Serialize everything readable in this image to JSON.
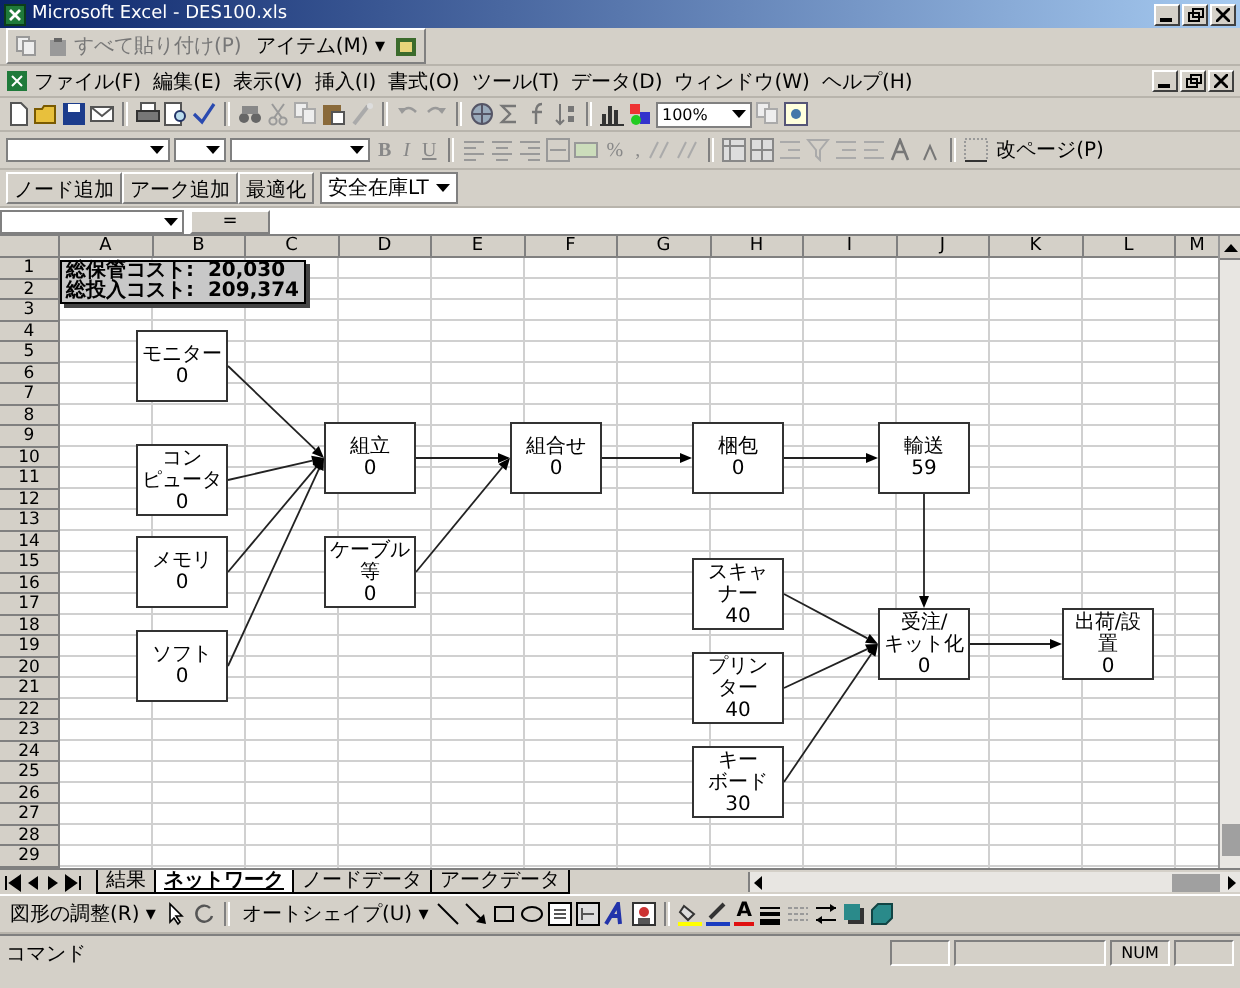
{
  "window": {
    "title": "Microsoft Excel - DES100.xls"
  },
  "paste_toolbar": {
    "paste_all": "すべて貼り付け(P)",
    "items_menu": "アイテム(M) ▾"
  },
  "menu": [
    "ファイル(F)",
    "編集(E)",
    "表示(V)",
    "挿入(I)",
    "書式(O)",
    "ツール(T)",
    "データ(D)",
    "ウィンドウ(W)",
    "ヘルプ(H)"
  ],
  "standard_toolbar": {
    "zoom": "100%"
  },
  "formatting_toolbar": {
    "style_buttons": [
      "B",
      "I",
      "U"
    ],
    "number_buttons": [
      "%",
      ","
    ],
    "page_break": "改ページ(P)"
  },
  "custom_toolbar": {
    "buttons": [
      "ノード追加",
      "アーク追加",
      "最適化"
    ],
    "dropdown": "安全在庫LT"
  },
  "formula_bar": {
    "equals": "="
  },
  "sheet": {
    "columns": [
      "A",
      "B",
      "C",
      "D",
      "E",
      "F",
      "G",
      "H",
      "I",
      "J",
      "K",
      "L",
      "M"
    ],
    "rows": [
      "1",
      "2",
      "3",
      "4",
      "5",
      "6",
      "7",
      "8",
      "9",
      "10",
      "11",
      "12",
      "13",
      "14",
      "15",
      "16",
      "17",
      "18",
      "19",
      "20",
      "21",
      "22",
      "23",
      "24",
      "25",
      "26",
      "27",
      "28",
      "29"
    ],
    "summary": [
      "総保管コスト:  20,030",
      "総投入コスト:  209,374"
    ],
    "nodes": [
      {
        "label_lines": [
          "モニター"
        ],
        "value": "0"
      },
      {
        "label_lines": [
          "コン",
          "ピュータ"
        ],
        "value": "0"
      },
      {
        "label_lines": [
          "メモリ"
        ],
        "value": "0"
      },
      {
        "label_lines": [
          "ソフト"
        ],
        "value": "0"
      },
      {
        "label_lines": [
          "組立"
        ],
        "value": "0"
      },
      {
        "label_lines": [
          "ケーブル",
          "等"
        ],
        "value": "0"
      },
      {
        "label_lines": [
          "組合せ"
        ],
        "value": "0"
      },
      {
        "label_lines": [
          "梱包"
        ],
        "value": "0"
      },
      {
        "label_lines": [
          "輸送"
        ],
        "value": "59"
      },
      {
        "label_lines": [
          "スキャ",
          "ナー"
        ],
        "value": "40"
      },
      {
        "label_lines": [
          "受注/",
          "キット化"
        ],
        "value": "0"
      },
      {
        "label_lines": [
          "プリン",
          "ター"
        ],
        "value": "40"
      },
      {
        "label_lines": [
          "キー",
          "ボード"
        ],
        "value": "30"
      },
      {
        "label_lines": [
          "出荷/設",
          "置"
        ],
        "value": "0"
      }
    ]
  },
  "sheet_tabs": [
    {
      "label": "結果",
      "selected": false
    },
    {
      "label": "ネットワーク",
      "selected": true
    },
    {
      "label": "ノードデータ",
      "selected": false
    },
    {
      "label": "アークデータ",
      "selected": false
    }
  ],
  "drawing_toolbar": {
    "draw_menu": "図形の調整(R) ▾",
    "autoshapes": "オートシェイプ(U) ▾",
    "font_color_letter": "A"
  },
  "status_bar": {
    "mode": "コマンド",
    "num": "NUM"
  }
}
